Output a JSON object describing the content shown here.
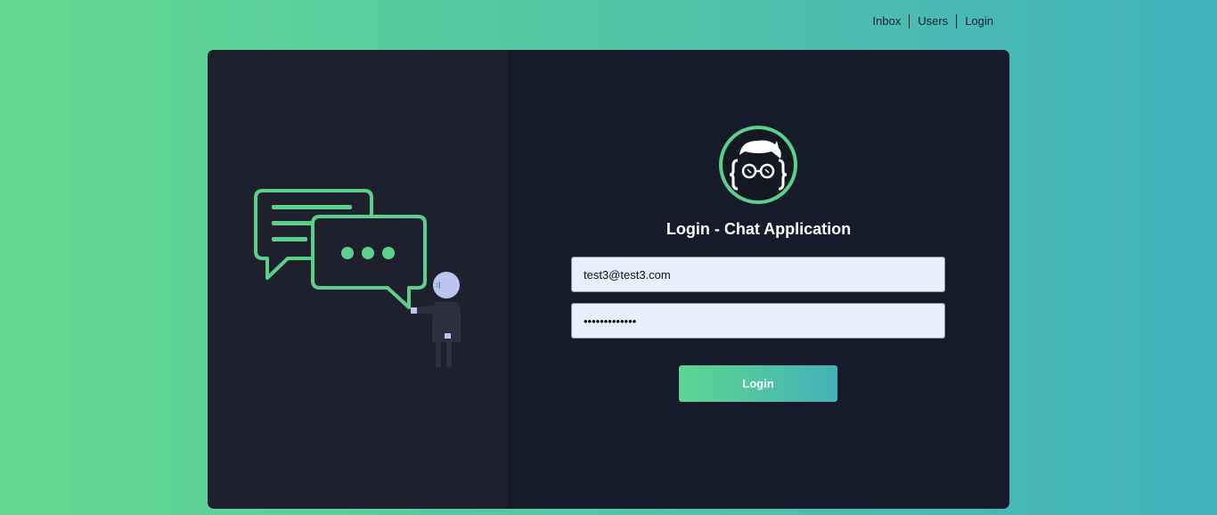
{
  "nav": {
    "items": [
      {
        "label": "Inbox"
      },
      {
        "label": "Users"
      },
      {
        "label": "Login"
      }
    ]
  },
  "login": {
    "title": "Login - Chat Application",
    "email_value": "test3@test3.com",
    "password_value": "passwordpassw",
    "button_label": "Login"
  },
  "illustration": {
    "icons": [
      "chat-bubbles-icon",
      "person-figure-icon"
    ],
    "accent_color": "#5ad18a"
  },
  "logo": {
    "icon": "developer-avatar-icon",
    "ring_color": "#5ad18a"
  },
  "colors": {
    "background_gradient_start": "#63d98f",
    "background_gradient_end": "#41b1bc",
    "left_panel": "#1f202d",
    "right_panel": "#161b2b",
    "input_bg": "#e8f0fe"
  }
}
